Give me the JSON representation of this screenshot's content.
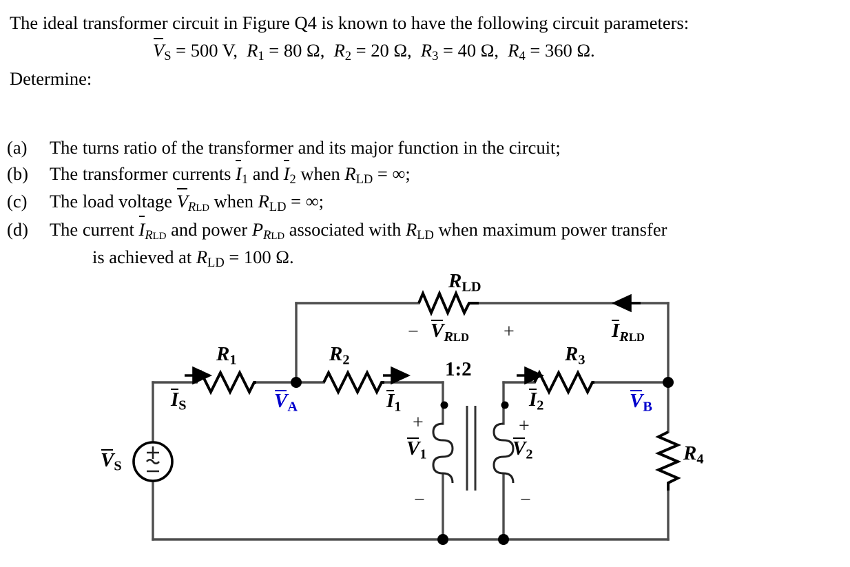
{
  "document": {
    "intro_line1": "The ideal transformer circuit in Figure Q4 is known to have the following circuit",
    "intro_line2": "parameters:",
    "determine_label": "Determine:",
    "parameters": {
      "vs": {
        "symbol": "V",
        "subscript": "S",
        "value": "500 V"
      },
      "r1": {
        "symbol": "R",
        "subscript": "1",
        "value": "80 Ω"
      },
      "r2": {
        "symbol": "R",
        "subscript": "2",
        "value": "20 Ω"
      },
      "r3": {
        "symbol": "R",
        "subscript": "3",
        "value": "40 Ω"
      },
      "r4": {
        "symbol": "R",
        "subscript": "4",
        "value": "360 Ω"
      },
      "full_text": "V̅S = 500 V, R1 = 80 Ω, R2 = 20 Ω, R3 = 40 Ω, R4 = 360 Ω."
    },
    "questions": [
      {
        "marker": "(a)",
        "text": "The turns ratio of the transformer and its major function in the circuit;"
      },
      {
        "marker": "(b)",
        "text": "The transformer currents I̅1 and I̅2 when RLD = ∞;"
      },
      {
        "marker": "(c)",
        "text": "The load voltage V̅RLD when RLD = ∞;"
      },
      {
        "marker": "(d)",
        "text": "The current I̅RLD and power PRLD associated with RLD when maximum power transfer is achieved at RLD = 100 Ω.",
        "line2": "is achieved at RLD = 100 Ω."
      }
    ]
  },
  "circuit": {
    "title_reference": "Figure Q4",
    "turns_ratio": "1:2",
    "colors": {
      "wire": "#4d4d4d",
      "component": "#000000",
      "node_voltage": "#0000CC",
      "label": "#000000"
    },
    "labels": {
      "vs": "V̅S",
      "is": "I̅S",
      "r1": "R₁",
      "va": "V̅A",
      "r2": "R₂",
      "i1": "I̅1",
      "v1": "V̅1",
      "v2": "V̅2",
      "i2": "I̅2",
      "r3": "R₃",
      "vb": "V̅B",
      "r4": "R₄",
      "rld": "Rₗₑ",
      "vrld": "V̅RLD",
      "irld": "I̅RLD",
      "ratio": "1:2",
      "plus": "+",
      "minus": "−"
    },
    "polarity_marks": {
      "vrld_minus": "−",
      "vrld_plus": "+",
      "v1_plus": "+",
      "v1_minus": "−",
      "v2_plus": "+",
      "v2_minus": "−"
    },
    "source": {
      "type": "ac-voltage-source",
      "plus": "+",
      "wave": "∼",
      "minus": "−"
    }
  }
}
